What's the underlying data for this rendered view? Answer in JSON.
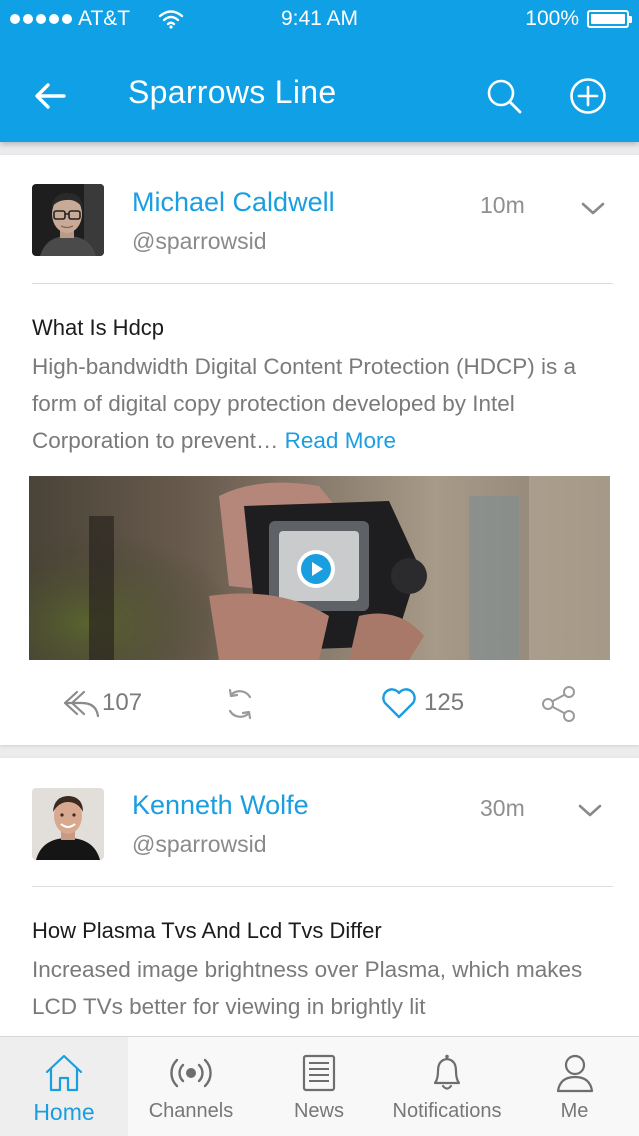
{
  "status_bar": {
    "carrier": "AT&T",
    "time": "9:41 AM",
    "battery": "100%"
  },
  "nav": {
    "title": "Sparrows Line"
  },
  "posts": [
    {
      "author": "Michael Caldwell",
      "handle": "@sparrowsid",
      "time": "10m",
      "title": "What Is Hdcp",
      "body": "High-bandwidth Digital Content Protection (HDCP) is a form of digital copy protection developed by Intel Corporation to prevent…",
      "read_more": "Read More",
      "replies": "107",
      "likes": "125"
    },
    {
      "author": "Kenneth Wolfe",
      "handle": "@sparrowsid",
      "time": "30m",
      "title": "How Plasma Tvs And Lcd Tvs Differ",
      "body": "Increased image brightness over Plasma, which makes LCD TVs better for viewing in brightly lit"
    }
  ],
  "tabbar": {
    "items": [
      {
        "label": "Home",
        "icon": "home-icon",
        "active": true
      },
      {
        "label": "Channels",
        "icon": "broadcast-icon"
      },
      {
        "label": "News",
        "icon": "newspaper-icon"
      },
      {
        "label": "Notifications",
        "icon": "bell-icon"
      },
      {
        "label": "Me",
        "icon": "user-icon"
      }
    ]
  },
  "colors": {
    "primary": "#0fa0e6",
    "accent": "#1a9ee0",
    "text_muted": "#7a7a7a"
  }
}
